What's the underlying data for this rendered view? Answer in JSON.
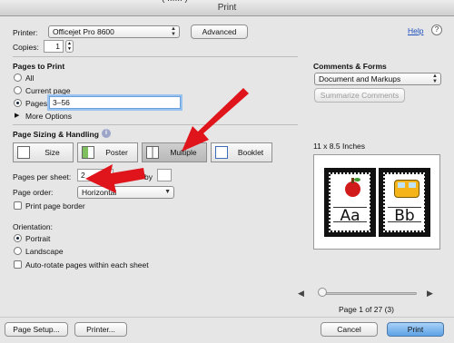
{
  "window": {
    "title": "Print",
    "clipped_text": "( ...... )"
  },
  "printer": {
    "label": "Printer:",
    "value": "Officejet Pro 8600",
    "advanced_label": "Advanced",
    "help_label": "Help"
  },
  "copies": {
    "label": "Copies:",
    "value": "1"
  },
  "pages": {
    "heading": "Pages to Print",
    "all_label": "All",
    "current_label": "Current page",
    "pages_label": "Pages",
    "pages_value": "3–56",
    "more_options": "More Options"
  },
  "sizing": {
    "heading": "Page Sizing & Handling",
    "tabs": [
      {
        "label": "Size",
        "selected": false
      },
      {
        "label": "Poster",
        "selected": false
      },
      {
        "label": "Multiple",
        "selected": true
      },
      {
        "label": "Booklet",
        "selected": false
      }
    ],
    "pages_per_sheet_label": "Pages per sheet:",
    "pages_per_sheet_value": "2",
    "by_label": "by",
    "by_value": "",
    "page_order_label": "Page order:",
    "page_order_value": "Horizontal",
    "print_border_label": "Print page border"
  },
  "orientation": {
    "heading": "Orientation:",
    "portrait_label": "Portrait",
    "landscape_label": "Landscape",
    "autorotate_label": "Auto-rotate pages within each sheet"
  },
  "comments": {
    "heading": "Comments & Forms",
    "value": "Document and Markups",
    "summarize_label": "Summarize Comments"
  },
  "preview": {
    "paper_size": "11 x 8.5 Inches",
    "left_card_letters": "Aa",
    "right_card_letters": "Bb",
    "page_status": "Page 1 of 27 (3)",
    "page_fraction": 0.0
  },
  "footer": {
    "page_setup_label": "Page Setup...",
    "printer_label": "Printer...",
    "cancel_label": "Cancel",
    "print_label": "Print"
  },
  "colors": {
    "arrow": "#e0141b",
    "accent": "#5da2e6"
  }
}
